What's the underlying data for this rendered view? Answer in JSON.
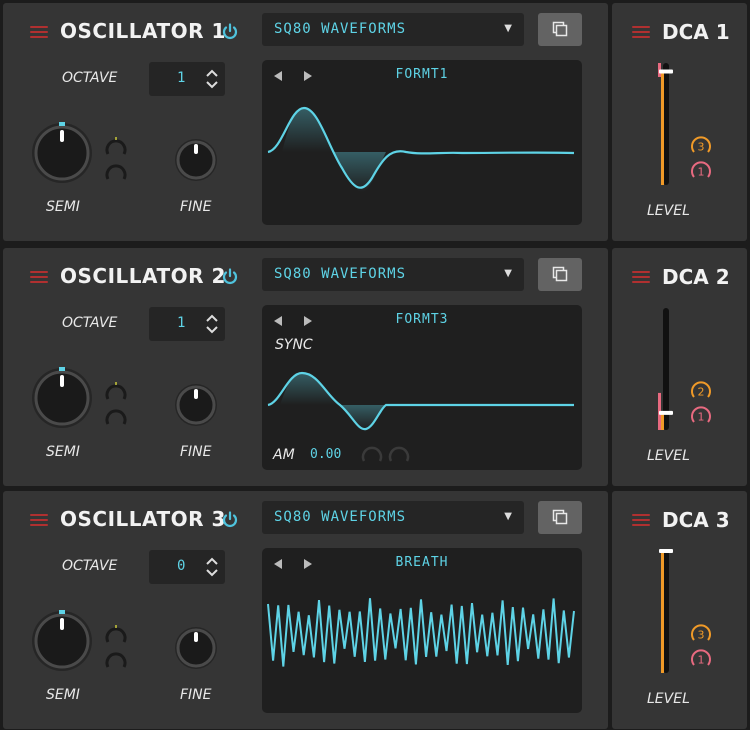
{
  "oscillators": [
    {
      "title": "OSCILLATOR 1",
      "preset": "SQ80 WAVEFORMS",
      "octave_label": "OCTAVE",
      "octave": "1",
      "semi_label": "SEMI",
      "fine_label": "FINE",
      "wave_name": "FORMT1",
      "sync_label": "",
      "am_label": "",
      "am_value": ""
    },
    {
      "title": "OSCILLATOR 2",
      "preset": "SQ80 WAVEFORMS",
      "octave_label": "OCTAVE",
      "octave": "1",
      "semi_label": "SEMI",
      "fine_label": "FINE",
      "wave_name": "FORMT3",
      "sync_label": "SYNC",
      "am_label": "AM",
      "am_value": "0.00"
    },
    {
      "title": "OSCILLATOR 3",
      "preset": "SQ80 WAVEFORMS",
      "octave_label": "OCTAVE",
      "octave": "0",
      "semi_label": "SEMI",
      "fine_label": "FINE",
      "wave_name": "BREATH",
      "sync_label": "",
      "am_label": "",
      "am_value": ""
    }
  ],
  "dcas": [
    {
      "title": "DCA 1",
      "level_label": "LEVEL",
      "level": 0.93,
      "mod_a": "3",
      "mod_b": "1"
    },
    {
      "title": "DCA 2",
      "level_label": "LEVEL",
      "level": 0.14,
      "mod_a": "2",
      "mod_b": "1"
    },
    {
      "title": "DCA 3",
      "level_label": "LEVEL",
      "level": 1.0,
      "mod_a": "3",
      "mod_b": "1"
    }
  ],
  "colors": {
    "accent": "#5ed3e6",
    "menu_red": "#b03030",
    "slider_orange": "#f09a28",
    "slider_pink": "#e86a80"
  },
  "icons": {
    "menu": "hamburger-menu-icon",
    "power": "power-icon",
    "copy": "copy-icon",
    "prev": "triangle-left-icon",
    "next": "triangle-right-icon"
  }
}
